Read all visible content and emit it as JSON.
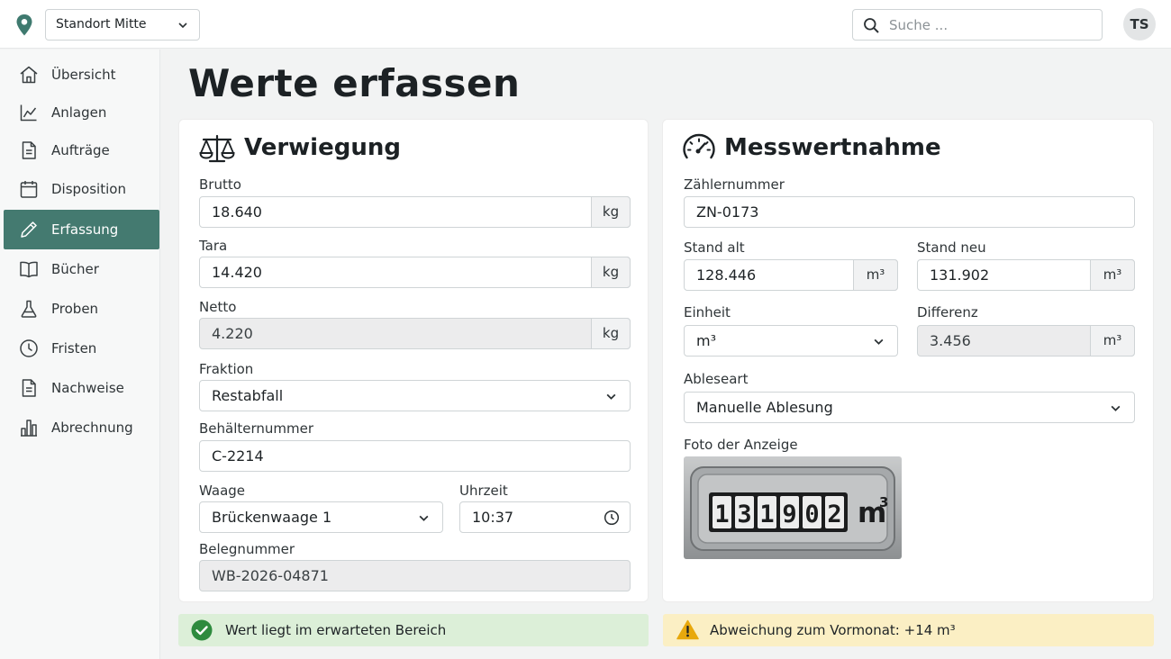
{
  "topbar": {
    "location_value": "Standort Mitte",
    "search_placeholder": "Suche ...",
    "avatar_initials": "TS"
  },
  "sidebar": {
    "items": [
      {
        "label": "Übersicht",
        "icon": "home-icon"
      },
      {
        "label": "Anlagen",
        "icon": "chart-line-icon"
      },
      {
        "label": "Aufträge",
        "icon": "document-icon"
      },
      {
        "label": "Disposition",
        "icon": "calendar-icon"
      },
      {
        "label": "Erfassung",
        "icon": "pencil-icon",
        "active": true
      },
      {
        "label": "Bücher",
        "icon": "book-icon"
      },
      {
        "label": "Proben",
        "icon": "flask-icon"
      },
      {
        "label": "Fristen",
        "icon": "clock-icon"
      },
      {
        "label": "Nachweise",
        "icon": "document-icon"
      },
      {
        "label": "Abrechnung",
        "icon": "bar-chart-icon"
      }
    ]
  },
  "page": {
    "title": "Werte erfassen"
  },
  "weighing": {
    "title": "Verwiegung",
    "icon": "scale-icon",
    "brutto_label": "Brutto",
    "brutto_value": "18.640",
    "brutto_unit": "kg",
    "tara_label": "Tara",
    "tara_value": "14.420",
    "tara_unit": "kg",
    "netto_label": "Netto",
    "netto_value": "4.220",
    "netto_unit": "kg",
    "fraktion_label": "Fraktion",
    "fraktion_value": "Restabfall",
    "container_label": "Behälternummer",
    "container_value": "C-2214",
    "scale_label": "Waage",
    "scale_value": "Brückenwaage 1",
    "time_label": "Uhrzeit",
    "time_value": "10:37",
    "receipt_label": "Belegnummer",
    "receipt_value": "WB-2026-04871"
  },
  "metering": {
    "title": "Messwertnahme",
    "icon": "gauge-icon",
    "meter_no_label": "Zählernummer",
    "meter_no_value": "ZN-0173",
    "old_label": "Stand alt",
    "old_value": "128.446",
    "old_unit": "m³",
    "new_label": "Stand neu",
    "new_value": "131.902",
    "new_unit": "m³",
    "unit_label": "Einheit",
    "unit_value": "m³",
    "diff_label": "Differenz",
    "diff_value": "3.456",
    "diff_unit": "m³",
    "read_type_label": "Ableseart",
    "read_type_value": "Manuelle Ablesung",
    "photo_label": "Foto der Anzeige",
    "photo_digits": [
      "1",
      "3",
      "1",
      "9",
      "0",
      "2"
    ],
    "photo_unit": "m",
    "photo_unit_exp": "3"
  },
  "status": {
    "ok_text": "Wert liegt im erwarteten Bereich",
    "ok_color": "#2e8b3e",
    "warn_text": "Abweichung zum Vormonat: +14 m³",
    "warn_color": "#e8a80c"
  },
  "colors": {
    "accent": "#447a70"
  }
}
